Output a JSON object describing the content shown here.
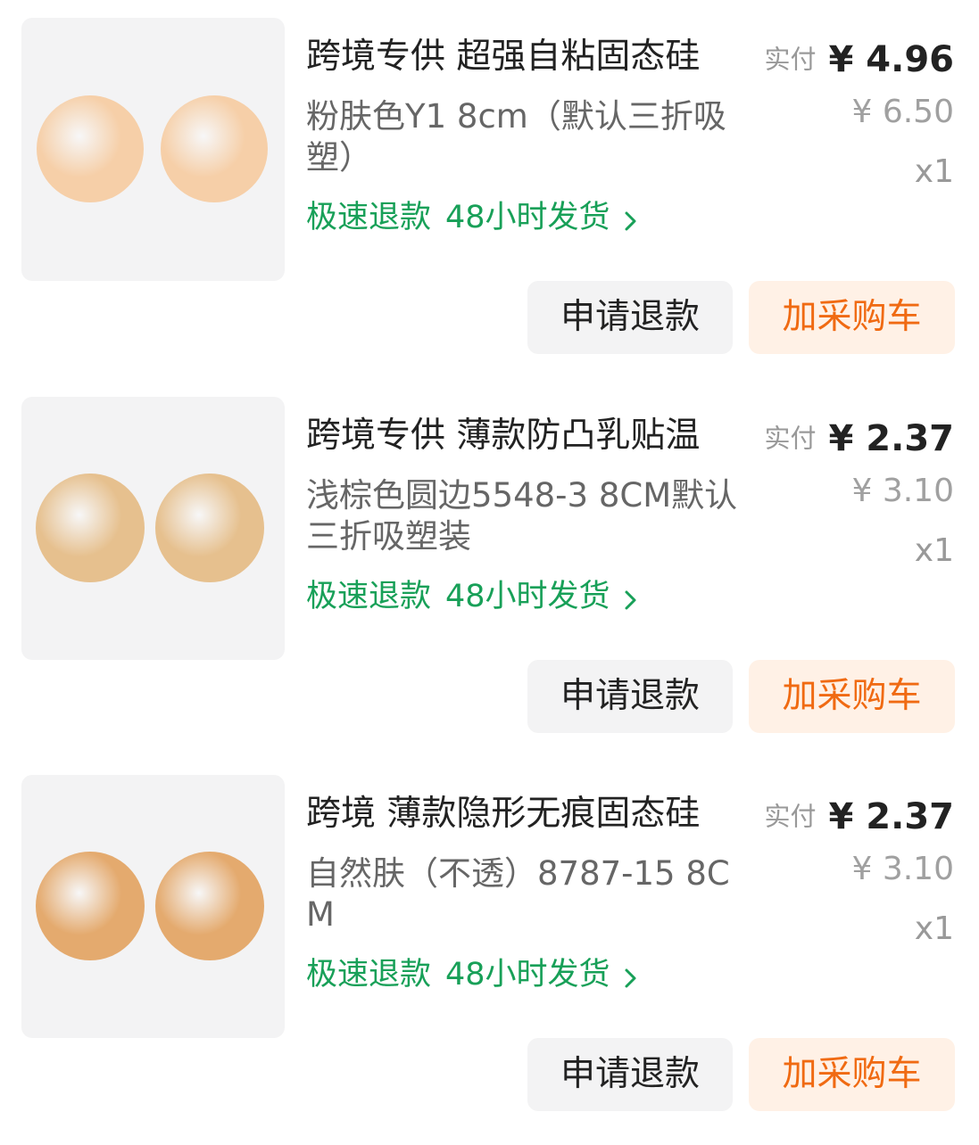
{
  "colors": {
    "tag_green": "#18a058",
    "cart_orange": "#f06a12",
    "cart_bg": "#fff1e6",
    "button_grey_bg": "#f3f3f4"
  },
  "items": [
    {
      "title": "跨境专供 超强自粘固态硅",
      "spec": "粉肤色Y1 8cm（默认三折吸塑）",
      "tag_refund": "极速退款",
      "tag_ship": "48小时发货",
      "paid_label": "实付",
      "paid_price": "¥ 4.96",
      "orig_price": "¥ 6.50",
      "qty": "x1",
      "refund_button": "申请退款",
      "cart_button": "加采购车",
      "disc_color": "#f6cfa8"
    },
    {
      "title": "跨境专供 薄款防凸乳贴温",
      "spec": "浅棕色圆边5548-3 8CM默认三折吸塑装",
      "tag_refund": "极速退款",
      "tag_ship": "48小时发货",
      "paid_label": "实付",
      "paid_price": "¥ 2.37",
      "orig_price": "¥ 3.10",
      "qty": "x1",
      "refund_button": "申请退款",
      "cart_button": "加采购车",
      "disc_color": "#e6c08e"
    },
    {
      "title": "跨境 薄款隐形无痕固态硅",
      "spec": "自然肤（不透）8787-15 8CM",
      "tag_refund": "极速退款",
      "tag_ship": "48小时发货",
      "paid_label": "实付",
      "paid_price": "¥ 2.37",
      "orig_price": "¥ 3.10",
      "qty": "x1",
      "refund_button": "申请退款",
      "cart_button": "加采购车",
      "disc_color": "#e4aa6e"
    }
  ]
}
